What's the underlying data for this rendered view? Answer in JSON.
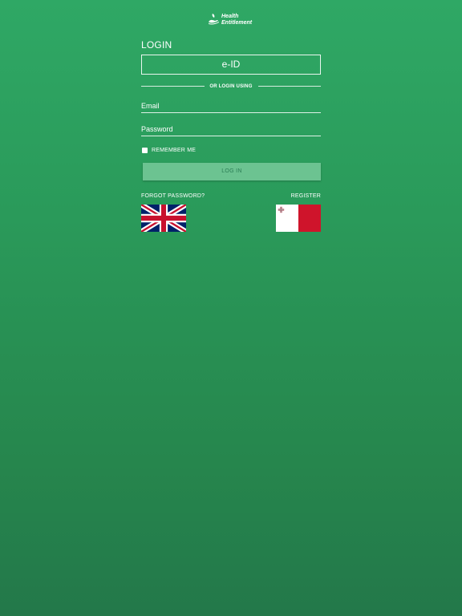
{
  "logo": {
    "line1": "Health",
    "line2": "Entitlement"
  },
  "login": {
    "title": "LOGIN",
    "eid_button": "e-ID",
    "divider_text": "OR LOGIN USING",
    "email_placeholder": "Email",
    "email_value": "",
    "password_placeholder": "Password",
    "password_value": "",
    "remember_label": "REMEMBER ME",
    "remember_checked": false,
    "login_button": "LOG IN",
    "forgot_link": "FORGOT PASSWORD?",
    "register_link": "REGISTER"
  },
  "languages": [
    {
      "flag": "uk-flag-icon"
    },
    {
      "flag": "malta-flag-icon"
    }
  ],
  "colors": {
    "background_top": "#2fa865",
    "background_bottom": "#23784a",
    "button_bg": "#6cc391",
    "button_text": "#2a7d55"
  }
}
